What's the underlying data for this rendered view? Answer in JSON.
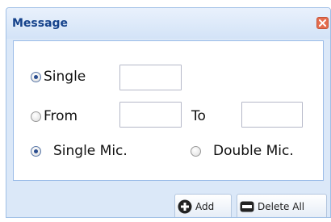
{
  "dialog": {
    "title": "Message",
    "close_icon": "close-icon"
  },
  "range": {
    "single_label": "Single",
    "single_value": "",
    "from_label": "From",
    "from_value": "",
    "to_label": "To",
    "to_value": "",
    "selected": "single"
  },
  "mic": {
    "single_label": "Single Mic.",
    "double_label": "Double Mic.",
    "selected": "single"
  },
  "toolbar": {
    "add_label": "Add",
    "add_icon": "add-icon",
    "delete_all_label": "Delete All",
    "delete_icon": "delete-icon"
  },
  "colors": {
    "title_text": "#15428b",
    "close_button": "#e46d4f",
    "panel_border": "#99bbe8",
    "dialog_background": "#dbe8f8"
  }
}
